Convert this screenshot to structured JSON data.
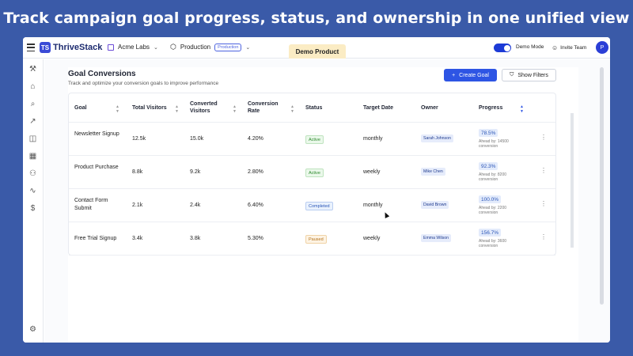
{
  "banner": {
    "text": "Track campaign goal progress, status, and ownership in one unified view"
  },
  "topbar": {
    "logo_mark": "TS",
    "logo_text": "ThriveStack",
    "org": "Acme Labs",
    "environment": "Production",
    "env_badge": "Production",
    "demo_product": "Demo Product",
    "demo_mode": "Demo Mode",
    "demo_mode_on": true,
    "invite": "Invite Team",
    "avatar": "P"
  },
  "page": {
    "title": "Goal Conversions",
    "subtitle": "Track and optimize your conversion goals to improve performance",
    "create_label": "Create Goal",
    "filter_label": "Show Filters"
  },
  "table": {
    "headers": {
      "goal": "Goal",
      "visitors": "Total Visitors",
      "converted": "Converted Visitors",
      "rate": "Conversion Rate",
      "status": "Status",
      "target": "Target Date",
      "owner": "Owner",
      "progress": "Progress"
    },
    "rows": [
      {
        "goal": "Newsletter Signup",
        "visitors": "12.5k",
        "converted": "15.0k",
        "rate": "4.20%",
        "status": "Active",
        "target": "monthly",
        "owner": "Sarah Johnson",
        "progress": "78.5%",
        "ahead": "Ahead by: 14500 conversion"
      },
      {
        "goal": "Product Purchase",
        "visitors": "8.8k",
        "converted": "9.2k",
        "rate": "2.80%",
        "status": "Active",
        "target": "weekly",
        "owner": "Mike Chen",
        "progress": "92.3%",
        "ahead": "Ahead by: 8200 conversion"
      },
      {
        "goal": "Contact Form Submit",
        "visitors": "2.1k",
        "converted": "2.4k",
        "rate": "6.40%",
        "status": "Completed",
        "target": "monthly",
        "owner": "David Brown",
        "progress": "100.0%",
        "ahead": "Ahead by: 2200 conversion"
      },
      {
        "goal": "Free Trial Signup",
        "visitors": "3.4k",
        "converted": "3.8k",
        "rate": "5.30%",
        "status": "Paused",
        "target": "weekly",
        "owner": "Emma Wilson",
        "progress": "156.7%",
        "ahead": "Ahead by: 3600 conversion"
      }
    ]
  },
  "colors": {
    "background": "#3a5aa8",
    "accent": "#2e55e4",
    "active": "#2f8a2f",
    "completed": "#2b56b8",
    "paused": "#b5731e"
  }
}
